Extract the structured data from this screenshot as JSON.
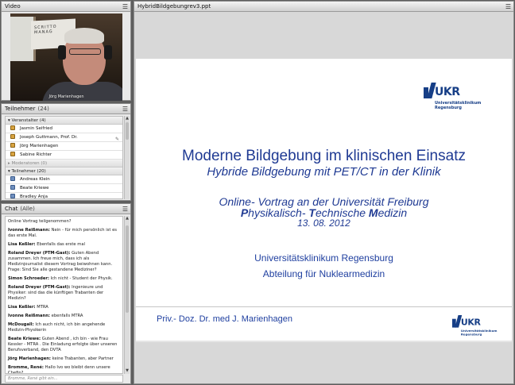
{
  "video": {
    "title": "Video",
    "whiteboard_text": "SCRITTO MANAG",
    "presenter_caption": "Jörg Marienhagen"
  },
  "participants": {
    "title": "Teilnehmer",
    "count": "(24)",
    "groups": [
      {
        "label": "Veranstalter (4)",
        "members": [
          "Jasmin Seifried",
          "Joseph Guttmann, Prof. Dr.",
          "Jörg Marienhagen",
          "Sabine Richter"
        ]
      },
      {
        "label": "Moderatoren (0)",
        "members": []
      },
      {
        "label": "Teilnehmer (20)",
        "members": [
          "Andreas Klein",
          "Beate Kriewe",
          "Bradley Anja"
        ]
      }
    ]
  },
  "chat": {
    "title": "Chat",
    "scope": "(Alle)",
    "messages": [
      {
        "sender": "",
        "text": "Online Vortrag teilgenommen?"
      },
      {
        "sender": "Ivonne Reißmann:",
        "text": "Nein - für mich persönlich ist es das erste Mal."
      },
      {
        "sender": "Lisa Keßler:",
        "text": "Ebenfalls das erste mal"
      },
      {
        "sender": "Roland Dreyer (PTM-Gast):",
        "text": "Guten Abend zusammen. Ich freue mich, dass ich als Medizinjournalist diesem Vortrag beiwohnen kann. Frage: Sind Sie alle gestandene Mediziner?"
      },
      {
        "sender": "Simon Schroeder:",
        "text": "Ich nicht - Student der Physik."
      },
      {
        "sender": "Roland Dreyer (PTM-Gast):",
        "text": "Ingenieure und Physiker: sind das die künftigen Trabanten der Medizin?"
      },
      {
        "sender": "Lisa Keßler:",
        "text": "MTRA"
      },
      {
        "sender": "Ivonne Reißmann:",
        "text": "ebenfalls MTRA"
      },
      {
        "sender": "McDougall:",
        "text": "Ich auch nicht, ich bin angehende Medizin-Physikerin"
      },
      {
        "sender": "Beate Kriewe:",
        "text": "Guten Abend , ich bin - wie Frau Kessler - MTRA . Die Einladung erfolgte über unseren Berufsverband, den DVTA"
      },
      {
        "sender": "Jörg Marienhagen:",
        "text": "keine Trabanten, aber Partner"
      },
      {
        "sender": "Bromme, René:",
        "text": "Hallo Ivo wo bleibt denn unsere Chefin?"
      }
    ],
    "typing_indicator": "Bromme, René gibt ein..."
  },
  "slide": {
    "title": "HybridBildgebungrev3.ppt",
    "logo_text": "UKR",
    "logo_sub_1": "Universitätsklinikum",
    "logo_sub_2": "Regensburg",
    "heading": "Moderne Bildgebung im klinischen Einsatz",
    "subheading": "Hybride Bildgebung mit PET/CT in der Klinik",
    "talk_line": "Online- Vortrag an der Universität Freiburg",
    "institute_line": "Physikalisch- Technische Medizin",
    "date": "13. 08. 2012",
    "org_1": "Universitätsklinikum Regensburg",
    "org_2": "Abteilung für Nuklearmedizin",
    "author": "Priv.- Doz. Dr. med J. Marienhagen"
  },
  "colors": {
    "slide_blue": "#1f3a93",
    "logo_blue": "#163e86",
    "pod_background": "#e9e9e9",
    "app_background": "#5e5e5e"
  }
}
